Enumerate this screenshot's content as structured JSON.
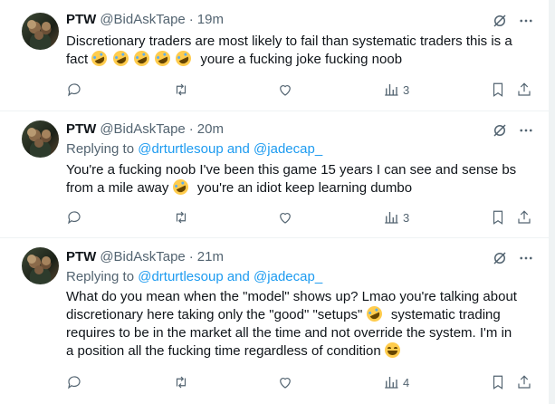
{
  "tweets": [
    {
      "name": "PTW",
      "handle": "@BidAskTape",
      "separator": "·",
      "time": "19m",
      "replying": null,
      "text_lines": [
        "Discretionary traders are most likely to fail than systematic traders this is a",
        "fact",
        "youre a fucking joke fucking noob"
      ],
      "views": "3"
    },
    {
      "name": "PTW",
      "handle": "@BidAskTape",
      "separator": "·",
      "time": "20m",
      "replying_prefix": "Replying to",
      "mention_1": "@drturtlesoup",
      "and_word": "and",
      "mention_2": "@jadecap_",
      "text_lines": [
        "You're a fucking noob I've been this game 15 years I can see and sense bs",
        "from a mile away",
        "you're an idiot keep learning dumbo"
      ],
      "views": "3"
    },
    {
      "name": "PTW",
      "handle": "@BidAskTape",
      "separator": "·",
      "time": "21m",
      "replying_prefix": "Replying to",
      "mention_1": "@drturtlesoup",
      "and_word": "and",
      "mention_2": "@jadecap_",
      "text_lines": [
        "What do you mean when the \"model\" shows up? Lmao you're talking about",
        "discretionary here taking only the \"good\" \"setups\"",
        "systematic trading",
        "requires to be in the market all the time and not override the system. I'm in",
        "a position all the fucking time regardless of condition"
      ],
      "views": "4"
    }
  ],
  "icons": {
    "reply": "reply-icon",
    "retweet": "retweet-icon",
    "like": "heart-icon",
    "views": "views-icon",
    "bookmark": "bookmark-icon",
    "share": "share-icon",
    "grok": "grok-icon",
    "more": "more-icon"
  },
  "colors": {
    "text": "#0f1419",
    "secondary": "#536471",
    "mention": "#1d9bf0",
    "divider": "#eff3f4"
  }
}
